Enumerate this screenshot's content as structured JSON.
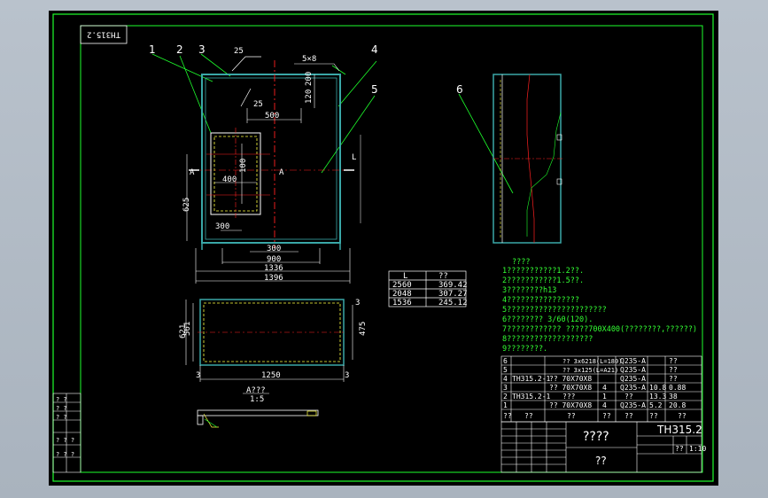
{
  "drawing": {
    "code_rotated": "TH315.2",
    "code": "TH315.2",
    "scale": "1:10",
    "name_placeholder": "????",
    "company_placeholder": "??",
    "row_marker": "??"
  },
  "balloons": [
    "1",
    "2",
    "3",
    "4",
    "5",
    "6"
  ],
  "front_dims": {
    "d25a": "25",
    "d25b": "25",
    "d120": "120",
    "d200": "200",
    "d500": "500",
    "d400": "400",
    "d100": "100",
    "d625": "625",
    "d300a": "300",
    "d300b": "300",
    "d900": "900",
    "d1336": "1336",
    "d1396": "1396",
    "d5x8": "5×8",
    "sec_a1": "A",
    "sec_a2": "A",
    "l_mark": "L"
  },
  "bottom_dims": {
    "d621": "621",
    "d561": "561",
    "d475": "475",
    "d1250": "1250",
    "d3a": "3",
    "d3b": "3",
    "d3c": "3"
  },
  "detail": {
    "title": "A???",
    "scale": "1:5"
  },
  "length_table": {
    "headers": [
      "L",
      "??"
    ],
    "rows": [
      [
        "2560",
        "369.42"
      ],
      [
        "2048",
        "307.27"
      ],
      [
        "1536",
        "245.12"
      ]
    ]
  },
  "notes": {
    "title": "????",
    "lines": [
      "1???????????1.2??.",
      "2???????????1.5??.",
      "3????????h13",
      "4????????????????",
      "5??????????????????????",
      "6???????? 3/60(120).",
      "7???????????? ?????700X400(????????,??????)",
      "8???????????????????",
      "9????????."
    ]
  },
  "bom": {
    "rows": [
      [
        "6",
        "",
        "??  3x6218(L=180)",
        "",
        "Q235-A",
        "",
        "??"
      ],
      [
        "5",
        "",
        "??  3x125(L=A21)",
        "",
        "Q235-A",
        "",
        "??"
      ],
      [
        "4",
        "TH315.2-1",
        "??  70X70X8",
        "",
        "Q235-A",
        "",
        "??"
      ],
      [
        "3",
        "",
        "??  70X70X8",
        "4",
        "Q235-A",
        "10.8",
        "0.88"
      ],
      [
        "2",
        "TH315.2-1",
        "???",
        "1",
        "??",
        "13.3",
        "38"
      ],
      [
        "1",
        "",
        "??  70X70X8",
        "4",
        "Q235-A",
        "5.2",
        "20.8"
      ]
    ],
    "header": [
      "??",
      "??",
      "??",
      "??",
      "??",
      "??",
      "??"
    ]
  },
  "left_block": {
    "rows": [
      "? ?",
      "? ?",
      "? ?",
      "? ? ?",
      "? ? ?"
    ]
  },
  "colors": {
    "frame": "#1eff2c",
    "steel": "#3aa8a8",
    "red": "#ff2020",
    "yellow": "#ffff40",
    "white": "#ffffff",
    "page": "#000000"
  }
}
